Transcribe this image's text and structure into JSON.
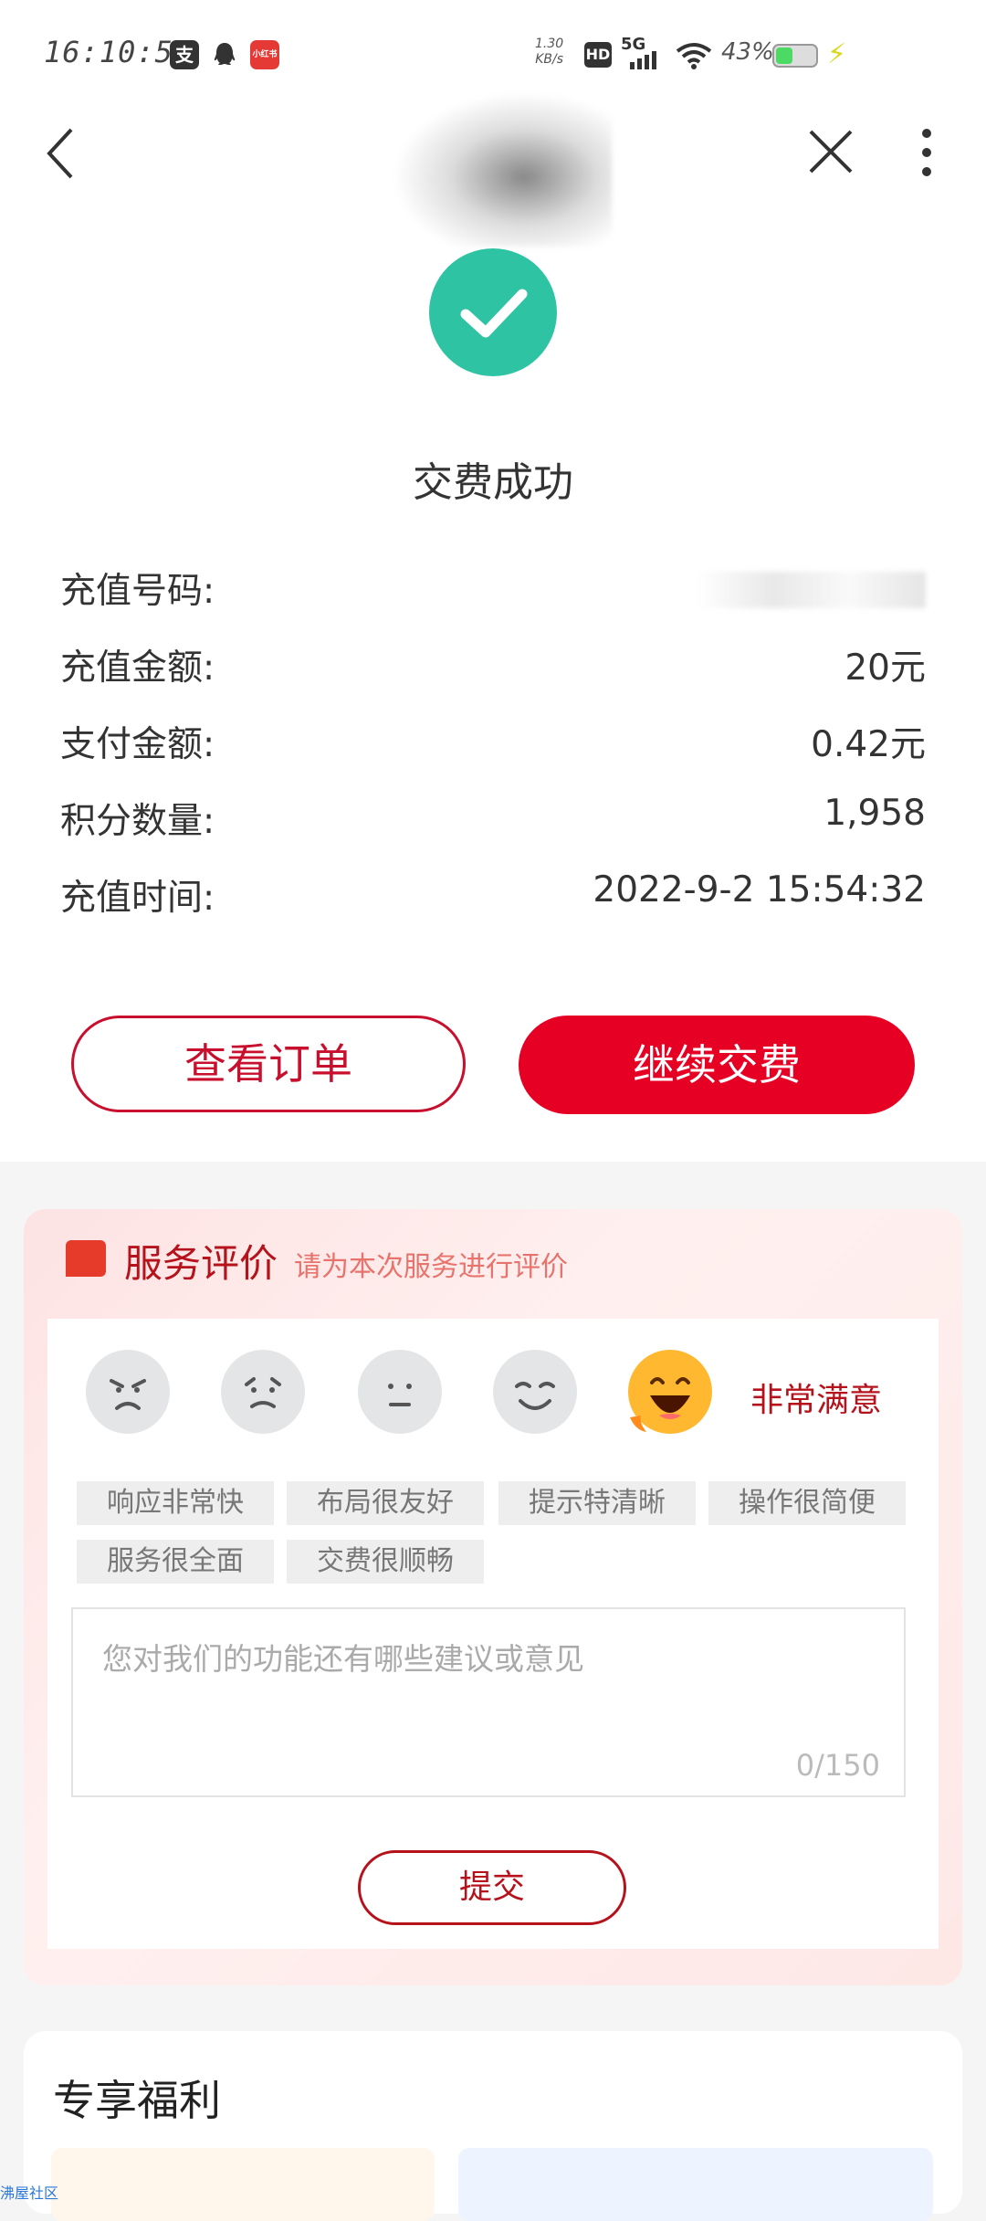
{
  "status_bar": {
    "time": "16:10:57",
    "app_icons": [
      {
        "name": "alipay-icon",
        "text": "支",
        "color": "#333333"
      },
      {
        "name": "qq-icon",
        "text": "",
        "color": "#333333"
      },
      {
        "name": "xiaohongshu-icon",
        "text": "",
        "color": "#e53935"
      }
    ],
    "net_speed_value": "1.30",
    "net_speed_unit": "KB/s",
    "hd_label": "HD",
    "network_label": "5G",
    "battery_percent": "43%",
    "battery_level": 0.43,
    "battery_fill_color": "#4cd964"
  },
  "nav": {
    "back_icon": "chevron-left-icon",
    "close_icon": "close-icon",
    "more_icon": "more-vertical-icon"
  },
  "result": {
    "status_icon": "check-circle-icon",
    "icon_color": "#2ec4a3",
    "title": "交费成功"
  },
  "details": [
    {
      "label": "充值号码:",
      "value": ""
    },
    {
      "label": "充值金额:",
      "value": "20元"
    },
    {
      "label": "支付金额:",
      "value": "0.42元"
    },
    {
      "label": "积分数量:",
      "value": "1,958"
    },
    {
      "label": "充值时间:",
      "value": "2022-9-2 15:54:32"
    }
  ],
  "actions": {
    "view_order": "查看订单",
    "continue_pay": "继续交费",
    "accent_color": "#e60023"
  },
  "evaluation": {
    "title": "服务评价",
    "subtitle": "请为本次服务进行评价",
    "faces": [
      "angry-face-icon",
      "sad-face-icon",
      "neutral-face-icon",
      "smile-face-icon",
      "very-happy-face-icon"
    ],
    "selected_label": "非常满意",
    "tags": [
      "响应非常快",
      "布局很友好",
      "提示特清晰",
      "操作很简便",
      "服务很全面",
      "交费很顺畅"
    ],
    "feedback_placeholder": "您对我们的功能还有哪些建议或意见",
    "char_count": "0/150",
    "submit": "提交"
  },
  "benefits": {
    "title": "专享福利"
  },
  "watermark": "沸屋社区"
}
